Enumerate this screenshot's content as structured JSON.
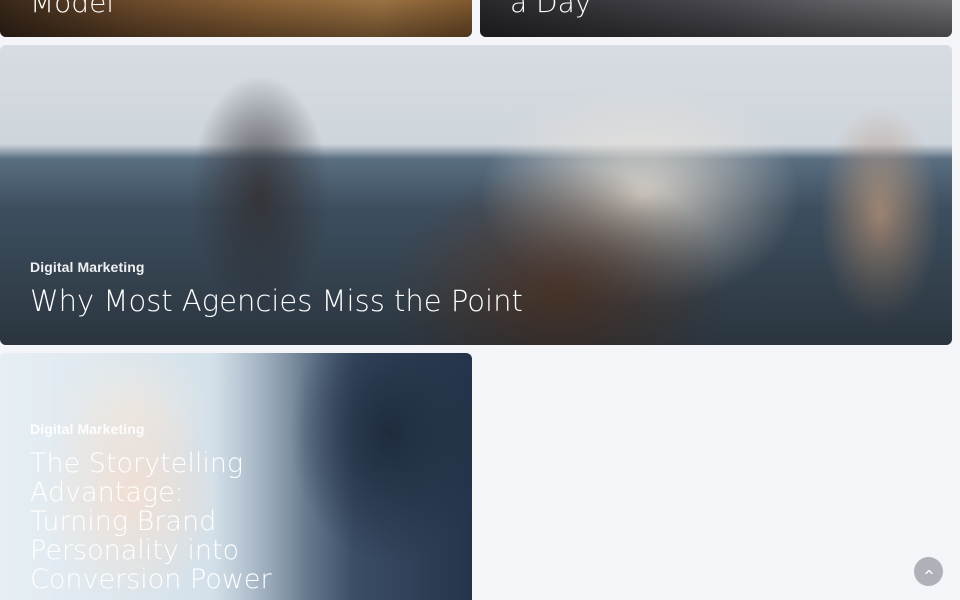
{
  "cards": {
    "top_left": {
      "title": "Model"
    },
    "top_right": {
      "title": "a Day"
    },
    "wide": {
      "category": "Digital Marketing",
      "title": "Why Most Agencies Miss the Point"
    },
    "lower_left": {
      "category": "Digital Marketing",
      "title": "The Storytelling Advantage: Turning Brand Personality into Conversion Power"
    }
  },
  "back_to_top": {
    "icon": "chevron-up-icon"
  },
  "colors": {
    "page_background": "#f4f5f8",
    "back_to_top": "#aeb1b8",
    "text": "#ffffff"
  }
}
